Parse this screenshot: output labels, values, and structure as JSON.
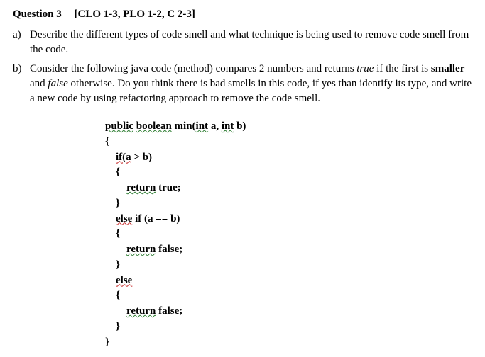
{
  "header": {
    "title": "Question 3",
    "tags": "[CLO 1-3, PLO 1-2, C 2-3]"
  },
  "parts": {
    "a": {
      "label": "a)",
      "text": "Describe the different types of code smell and what technique is being used to remove code smell from the code."
    },
    "b": {
      "label": "b)",
      "text_prefix": "Consider the following java code (method) compares 2 numbers and returns ",
      "true_word": "true",
      "text_mid1": " if the first is ",
      "smaller_word": "smaller",
      "text_mid2": " and ",
      "false_word": "false",
      "text_suffix": " otherwise. Do you think there is bad smells in this code, if yes than identify its type, and write a new code by using refactoring approach to remove the code smell."
    }
  },
  "code": {
    "l1_a": "public",
    "l1_b": " ",
    "l1_c": "boolean",
    "l1_d": " min(",
    "l1_e": "int",
    "l1_f": " a, ",
    "l1_g": "int",
    "l1_h": " b)",
    "l2": "{",
    "l3_a": "    ",
    "l3_b": "if(a",
    "l3_c": " > b)",
    "l4": "    {",
    "l5_a": "        ",
    "l5_b": "return",
    "l5_c": " true;",
    "l6": "    }",
    "l7_a": "    ",
    "l7_b": "else",
    "l7_c": " if (a == b)",
    "l8": "    {",
    "l9_a": "        ",
    "l9_b": "return",
    "l9_c": " false;",
    "l10": "    }",
    "l11_a": "    ",
    "l11_b": "else",
    "l12": "    {",
    "l13_a": "        ",
    "l13_b": "return",
    "l13_c": " false;",
    "l14": "    }",
    "l15": "}"
  }
}
